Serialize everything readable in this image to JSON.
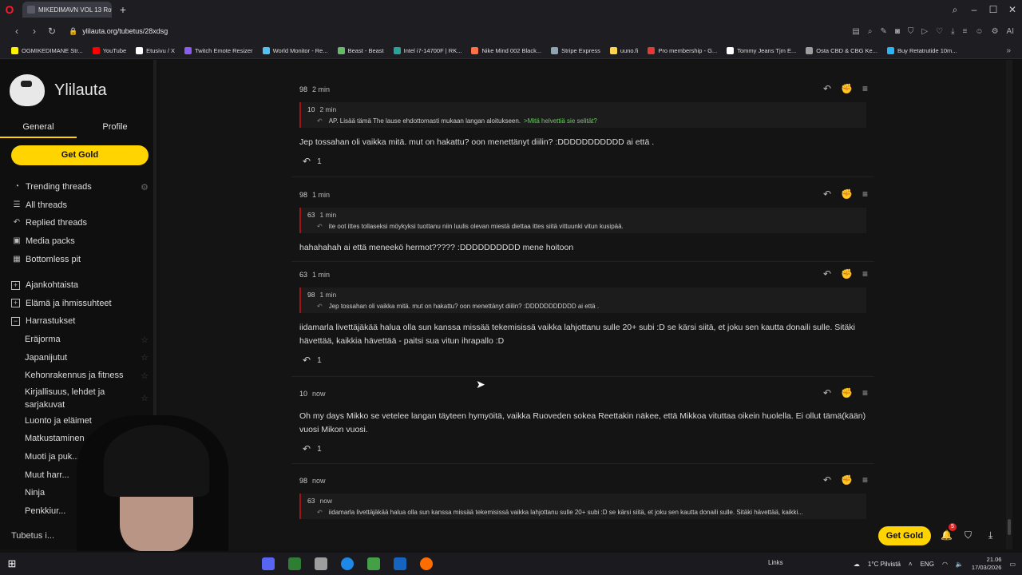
{
  "browser": {
    "tab_title": "MIKEDIMAVN VOL 13 Rov",
    "url": "ylilauta.org/tubetus/28xdsg",
    "bookmarks": [
      "OGMIKEDIMANE Str...",
      "YouTube",
      "Etusivu / X",
      "Twitch Emote Resizer",
      "World Monitor - Re...",
      "Beast - Beast",
      "Intel i7-14700F | RK...",
      "Nike Mind 002 Black...",
      "Stripe Express",
      "uuno.fi",
      "Pro membership - G...",
      "Tommy Jeans Tjm E...",
      "Osta CBD & CBG Ke...",
      "Buy Retatrutide 10m..."
    ]
  },
  "sidebar": {
    "logo": "Ylilauta",
    "tabs": [
      "General",
      "Profile"
    ],
    "gold_button": "Get Gold",
    "nav": [
      {
        "label": "Trending threads",
        "icon": "trending-icon"
      },
      {
        "label": "All threads",
        "icon": "list-icon"
      },
      {
        "label": "Replied threads",
        "icon": "reply-icon"
      },
      {
        "label": "Media packs",
        "icon": "media-icon"
      },
      {
        "label": "Bottomless pit",
        "icon": "pit-icon"
      }
    ],
    "categories": [
      {
        "label": "Ajankohtaista",
        "mark": "+"
      },
      {
        "label": "Elämä ja ihmissuhteet",
        "mark": "+"
      },
      {
        "label": "Harrastukset",
        "mark": "−"
      }
    ],
    "subcategories": [
      "Eräjorma",
      "Japanijutut",
      "Kehonrakennus ja fitness",
      "Kirjallisuus, lehdet ja sarjakuvat",
      "Luonto ja eläimet",
      "Matkustaminen",
      "Muoti ja puk...",
      "Muut harr...",
      "Ninja",
      "Penkkiur..."
    ],
    "footer": "Tubetus i..."
  },
  "posts": [
    {
      "num": "98",
      "time": "2 min",
      "quote": {
        "num": "10",
        "time": "2 min",
        "text": "AP. Lisää tämä The lause ehdottomasti mukaan langan aloitukseen.",
        "green": ">Mitä helvettiä sie selität?"
      },
      "body": "Jep tossahan oli vaikka mitä. mut on hakattu? oon menettänyt diilin? :DDDDDDDDDDD ai että .",
      "replies": "1"
    },
    {
      "num": "98",
      "time": "1 min",
      "quote": {
        "num": "63",
        "time": "1 min",
        "text": "ite oot ittes tollaseksi möykyksi tuottanu niin luulis olevan miestä diettaa ittes siitä vittuunki vitun kusipää.",
        "green": ""
      },
      "body": "hahahahah ai että meneekö hermot????? :DDDDDDDDDD mene hoitoon",
      "replies": ""
    },
    {
      "num": "63",
      "time": "1 min",
      "quote": {
        "num": "98",
        "time": "1 min",
        "text": "Jep tossahan oli vaikka mitä. mut on hakattu? oon menettänyt diilin? :DDDDDDDDDDD ai että .",
        "green": ""
      },
      "body": "iidamarla livettäjäkää halua olla sun kanssa missää tekemisissä vaikka lahjottanu sulle 20+ subi :D se kärsi siitä, et joku sen kautta donaili sulle. Sitäki hävettää, kaikkia hävettää - paitsi sua vitun ihrapallo :D",
      "replies": "1"
    },
    {
      "num": "10",
      "time": "now",
      "body": "Oh my days Mikko se vetelee langan täyteen hymyöitä, vaikka Ruoveden sokea Reettakin näkee, että Mikkoa vituttaa oikein huolella. Ei ollut tämä(kään) vuosi Mikon vuosi.",
      "replies": "1"
    },
    {
      "num": "98",
      "time": "now",
      "quote": {
        "num": "63",
        "time": "now",
        "text": "iidamarla livettäjäkää halua olla sun kanssa missää tekemisissä vaikka lahjottanu sulle 20+ subi :D se kärsi siitä, et joku sen kautta donaili sulle. Sitäki hävettää, kaikki...",
        "green": ""
      }
    }
  ],
  "floating": {
    "gold_button": "Get Gold",
    "notifications": "5"
  },
  "taskbar": {
    "links": "Links",
    "weather": "1°C Pilvistä",
    "lang": "ENG",
    "time": "21.06",
    "date": "17/03/2026"
  }
}
